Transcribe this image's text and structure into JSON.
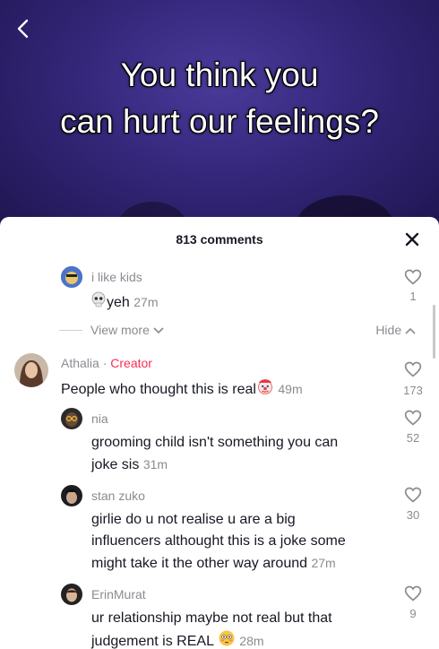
{
  "video": {
    "caption_line1": "You think you",
    "caption_line2": "can hurt our feelings?"
  },
  "sheet": {
    "comment_count": "813 comments"
  },
  "reply_thread": {
    "username": "i like kids",
    "text": "yeh",
    "time": "27m",
    "likes": "1",
    "view_more_label": "View more",
    "hide_label": "Hide"
  },
  "comments": [
    {
      "username": "Athalia",
      "separator": " · ",
      "badge": "Creator",
      "text": "People who thought this is real",
      "time": "49m",
      "likes": "173"
    },
    {
      "username": "nia",
      "text_line1": "grooming child isn't something you can",
      "text_line2": "joke sis",
      "time": "31m",
      "likes": "52"
    },
    {
      "username": "stan zuko",
      "text_line1": "girlie do u not realise u are a big",
      "text_line2": "influencers althought this is a joke some",
      "text_line3": "might take it the other way around",
      "time": "27m",
      "likes": "30"
    },
    {
      "username": "ErinMurat",
      "text_line1": "ur relationship maybe not real but that",
      "text_line2": "judgement is REAL",
      "time": "28m",
      "likes": "9"
    }
  ],
  "icons": {
    "back": "chevron-left-icon",
    "close": "close-icon",
    "like": "heart-outline-icon",
    "skull": "skull-emoji",
    "clown": "clown-emoji",
    "flushed": "flushed-emoji"
  },
  "colors": {
    "creator_badge": "#fe2c55",
    "muted_text": "#8a8b91"
  }
}
